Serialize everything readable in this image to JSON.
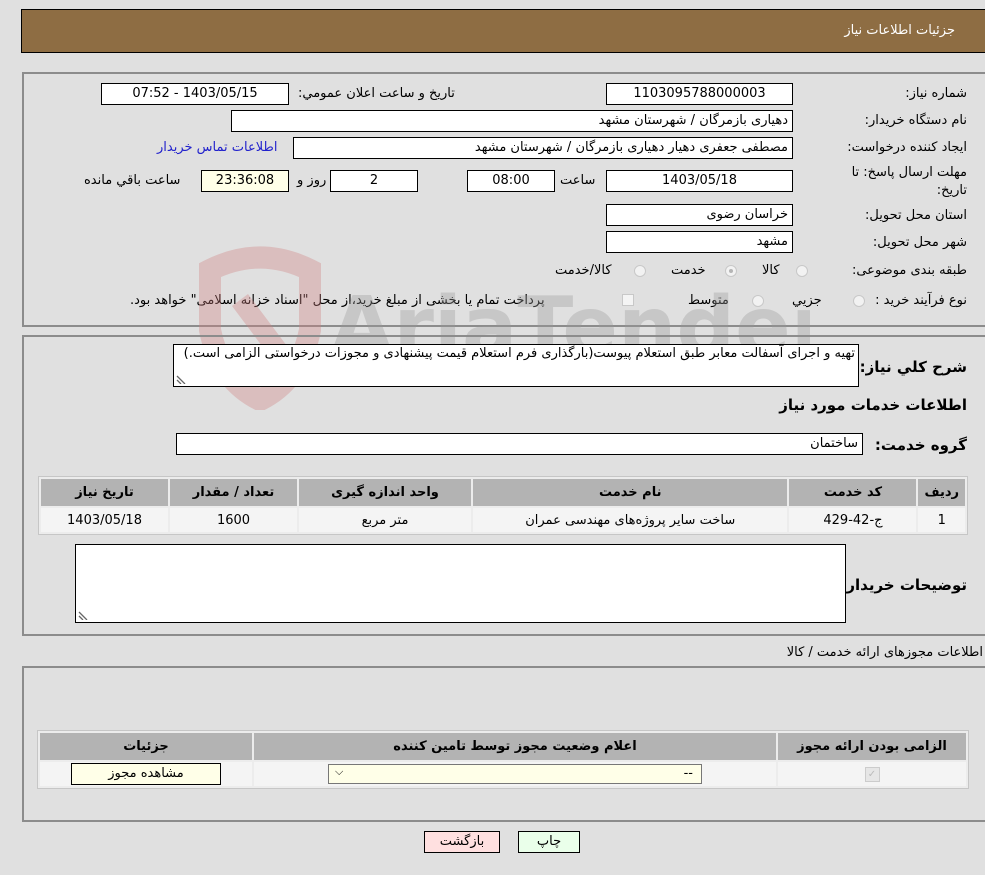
{
  "header": {
    "title": "جزئیات اطلاعات نیاز"
  },
  "form": {
    "need_number": {
      "label": "شماره نیاز:",
      "value": "1103095788000003"
    },
    "announce_datetime": {
      "label": "تاریخ و ساعت اعلان عمومي:",
      "value": "1403/05/15 - 07:52"
    },
    "buyer_org": {
      "label": "نام دستگاه خریدار:",
      "value": "دهیاری بازمرگان / شهرستان مشهد"
    },
    "requester": {
      "label": "ایجاد کننده درخواست:",
      "value": "مصطفی جعفری دهیار دهیاری بازمرگان / شهرستان مشهد"
    },
    "buyer_contact_link": "اطلاعات تماس خریدار",
    "deadline": {
      "label_line1": "مهلت ارسال پاسخ: تا",
      "label_line2": "تاریخ:",
      "date": "1403/05/18",
      "time_label": "ساعت",
      "time": "08:00",
      "days": "2",
      "days_label": "روز و",
      "remaining": "23:36:08",
      "remaining_label": "ساعت باقي مانده"
    },
    "province": {
      "label": "استان محل تحویل:",
      "value": "خراسان رضوی"
    },
    "city": {
      "label": "شهر محل تحویل:",
      "value": "مشهد"
    },
    "category": {
      "label": "طبقه بندی موضوعی:",
      "options": [
        "کالا",
        "خدمت",
        "کالا/خدمت"
      ],
      "selected": "خدمت"
    },
    "purchase_type": {
      "label": "نوع فرآیند خرید :",
      "options": [
        "جزيي",
        "متوسط"
      ],
      "treasury_note": "پرداخت تمام یا بخشی از مبلغ خرید،از محل \"اسناد خزانه اسلامی\" خواهد بود."
    }
  },
  "description": {
    "label": "شرح کلي نیاز:",
    "value": "تهیه و اجرای آسفالت معابر طبق استعلام پیوست(بارگذاری فرم استعلام قیمت پیشنهادی و مجوزات درخواستی الزامی است.)"
  },
  "services": {
    "section_title": "اطلاعات خدمات مورد نیاز",
    "group_label": "گروه خدمت:",
    "group_value": "ساختمان",
    "table": {
      "columns": [
        "ردیف",
        "کد خدمت",
        "نام خدمت",
        "واحد اندازه گیری",
        "تعداد / مقدار",
        "تاریخ نیاز"
      ],
      "rows": [
        [
          "1",
          "ج-42-429",
          "ساخت سایر پروژه‌های مهندسی عمران",
          "متر مربع",
          "1600",
          "1403/05/18"
        ]
      ]
    }
  },
  "buyer_notes": {
    "label": "توضیحات خریدار:",
    "value": ""
  },
  "permits": {
    "section_title": "اطلاعات مجوزهای ارائه خدمت / کالا",
    "table": {
      "columns": [
        "الزامی بودن ارائه مجوز",
        "اعلام وضعیت مجوز توسط تامین کننده",
        "جزئیات"
      ],
      "rows": [
        {
          "required": true,
          "status_selected": "--",
          "details_button": "مشاهده مجوز"
        }
      ]
    }
  },
  "footer": {
    "print_label": "چاپ",
    "back_label": "بازگشت"
  },
  "colors": {
    "header_bg": "#8e6d43",
    "print_bg": "#eaffea",
    "back_bg": "#ffe0e0",
    "link": "#2222cc"
  }
}
